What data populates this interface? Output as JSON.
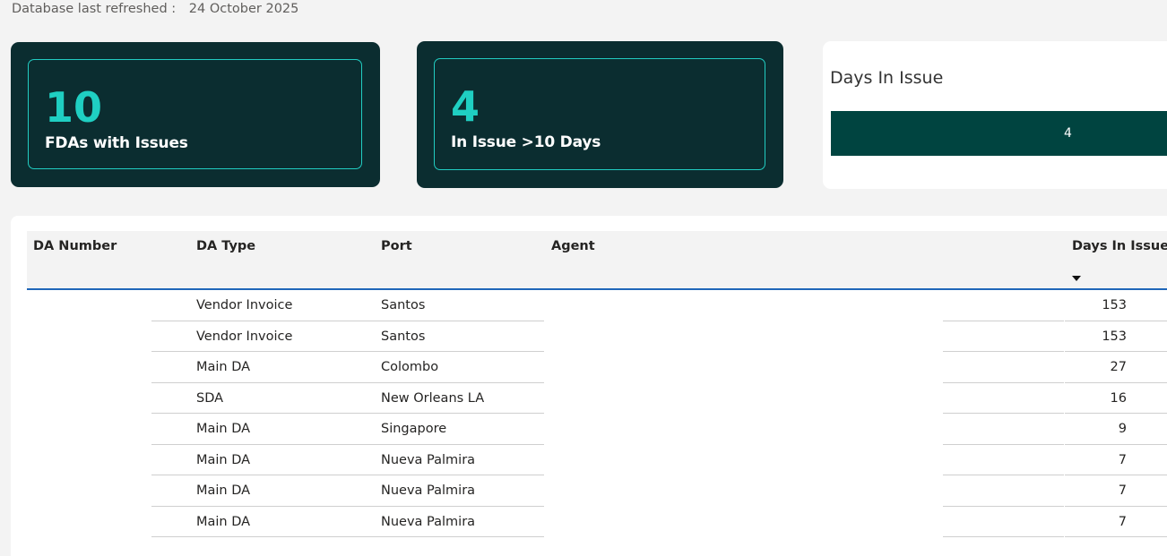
{
  "header": {
    "refresh_label": "Database last refreshed :",
    "refresh_date": "24 October 2025"
  },
  "kpis": [
    {
      "value": "10",
      "label": "FDAs with Issues"
    },
    {
      "value": "4",
      "label": "In Issue >10 Days"
    }
  ],
  "days_card": {
    "title": "Days In Issue",
    "bar_value": "4"
  },
  "table": {
    "columns": [
      "DA Number",
      "DA Type",
      "Port",
      "Agent",
      "Days In Issue"
    ],
    "sort": {
      "column": "Days In Issue",
      "direction": "descending"
    },
    "rows": [
      {
        "da_number": "",
        "da_type": "Vendor Invoice",
        "port": "Santos",
        "agent": "",
        "days": "153"
      },
      {
        "da_number": "",
        "da_type": "Vendor Invoice",
        "port": "Santos",
        "agent": "",
        "days": "153"
      },
      {
        "da_number": "",
        "da_type": "Main DA",
        "port": "Colombo",
        "agent": "",
        "days": "27"
      },
      {
        "da_number": "",
        "da_type": "SDA",
        "port": "New Orleans LA",
        "agent": "",
        "days": "16"
      },
      {
        "da_number": "",
        "da_type": "Main DA",
        "port": "Singapore",
        "agent": "",
        "days": "9"
      },
      {
        "da_number": "",
        "da_type": "Main DA",
        "port": "Nueva Palmira",
        "agent": "",
        "days": "7"
      },
      {
        "da_number": "",
        "da_type": "Main DA",
        "port": "Nueva Palmira",
        "agent": "",
        "days": "7"
      },
      {
        "da_number": "",
        "da_type": "Main DA",
        "port": "Nueva Palmira",
        "agent": "",
        "days": "7"
      }
    ]
  },
  "colors": {
    "kpi_background": "#0b2d30",
    "kpi_accent": "#1fcfc2",
    "bar_fill": "#004440",
    "header_rule": "#1f66b8"
  }
}
